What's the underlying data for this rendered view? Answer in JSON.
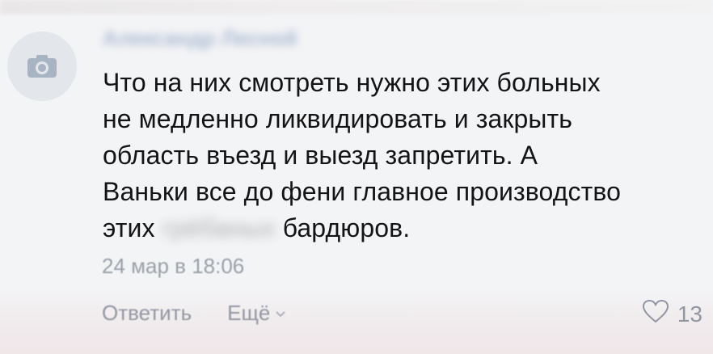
{
  "comment": {
    "author_name": "Александр Лесной",
    "text_lines": [
      "Что на них смотреть нужно этих больных",
      "не медленно ликвидировать и закрыть",
      "область въезд и выезд запретить. А",
      "Ваньки все до фени главное производство"
    ],
    "last_line_start": "этих",
    "last_line_blurred": "грёбаных",
    "last_line_end": "бардюров.",
    "timestamp": "24 мар в 18:06",
    "reply_label": "Ответить",
    "more_label": "Ещё",
    "likes_count": "13"
  },
  "icons": {
    "avatar": "camera-icon",
    "more": "chevron-down-icon",
    "like": "heart-icon"
  },
  "colors": {
    "background": "#f3f4f6",
    "text": "#141414",
    "meta": "#9aa0a8",
    "author": "#6d89b4",
    "avatar_bg": "#e3e6ea"
  }
}
